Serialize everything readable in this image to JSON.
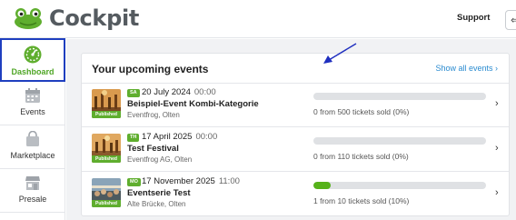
{
  "app": {
    "name": "Cockpit"
  },
  "header": {
    "support_label": "Support",
    "logout_icon": "logout-icon"
  },
  "sidebar": {
    "items": [
      {
        "label": "Dashboard",
        "icon": "gauge-icon",
        "active": true
      },
      {
        "label": "Events",
        "icon": "calendar-icon",
        "active": false
      },
      {
        "label": "Marketplace",
        "icon": "shopping-bag-icon",
        "active": false
      },
      {
        "label": "Presale",
        "icon": "store-icon",
        "active": false
      }
    ]
  },
  "events_card": {
    "title": "Your upcoming events",
    "show_all_label": "Show all events ›",
    "events": [
      {
        "day": "SA",
        "date": "20 July 2024",
        "time": "00:00",
        "title": "Beispiel-Event Kombi-Kategorie",
        "venue": "Eventfrog, Olten",
        "status": "Published",
        "sold_text": "0 from 500 tickets sold (0%)",
        "progress": 0
      },
      {
        "day": "TH",
        "date": "17 April 2025",
        "time": "00:00",
        "title": "Test Festival",
        "venue": "Eventfrog AG, Olten",
        "status": "Published",
        "sold_text": "0 from 110 tickets sold (0%)",
        "progress": 0
      },
      {
        "day": "MO",
        "date": "17 November 2025",
        "time": "11:00",
        "title": "Eventserie Test",
        "venue": "Alte Brücke, Olten",
        "status": "Published",
        "sold_text": "1 from 10 tickets sold (10%)",
        "progress": 0.1
      }
    ]
  },
  "colors": {
    "accent": "#5fae2e",
    "link": "#2a8bd0",
    "highlight_border": "#1f3fbf",
    "annotation_arrow": "#1f2fbf"
  }
}
